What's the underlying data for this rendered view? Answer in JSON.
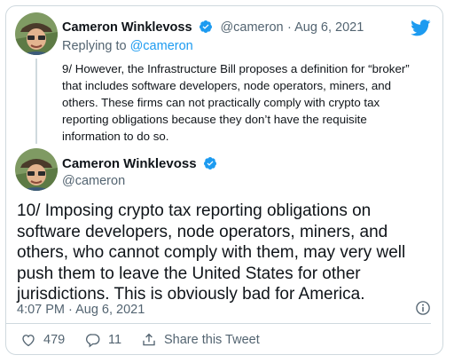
{
  "parent_tweet": {
    "author_name": "Cameron Winklevoss",
    "handle": "@cameron",
    "date": "Aug 6, 2021",
    "replying_prefix": "Replying to",
    "replying_to": "@cameron",
    "text": "9/ However, the Infrastructure Bill proposes a definition for “broker” that includes software developers, node operators, miners, and others. These firms can not practically comply with crypto tax reporting obligations because they don’t have the requisite information to do so."
  },
  "main_tweet": {
    "author_name": "Cameron Winklevoss",
    "handle": "@cameron",
    "text": "10/ Imposing crypto tax reporting obligations on software developers, node operators, miners, and others, who cannot comply with them, may very well push them to leave the United States for other jurisdictions. This is obviously bad for America.",
    "timestamp": "4:07 PM · Aug 6, 2021",
    "likes": "479",
    "replies": "11",
    "share_label": "Share this Tweet"
  },
  "icons": {
    "brand": "twitter-bird-icon",
    "verified": "verified-badge-icon",
    "info": "info-icon",
    "like": "heart-icon",
    "reply": "reply-icon",
    "share": "share-icon"
  },
  "colors": {
    "accent": "#1d9bf0",
    "text": "#0f1419",
    "muted": "#536471",
    "border": "#cfd9de"
  }
}
